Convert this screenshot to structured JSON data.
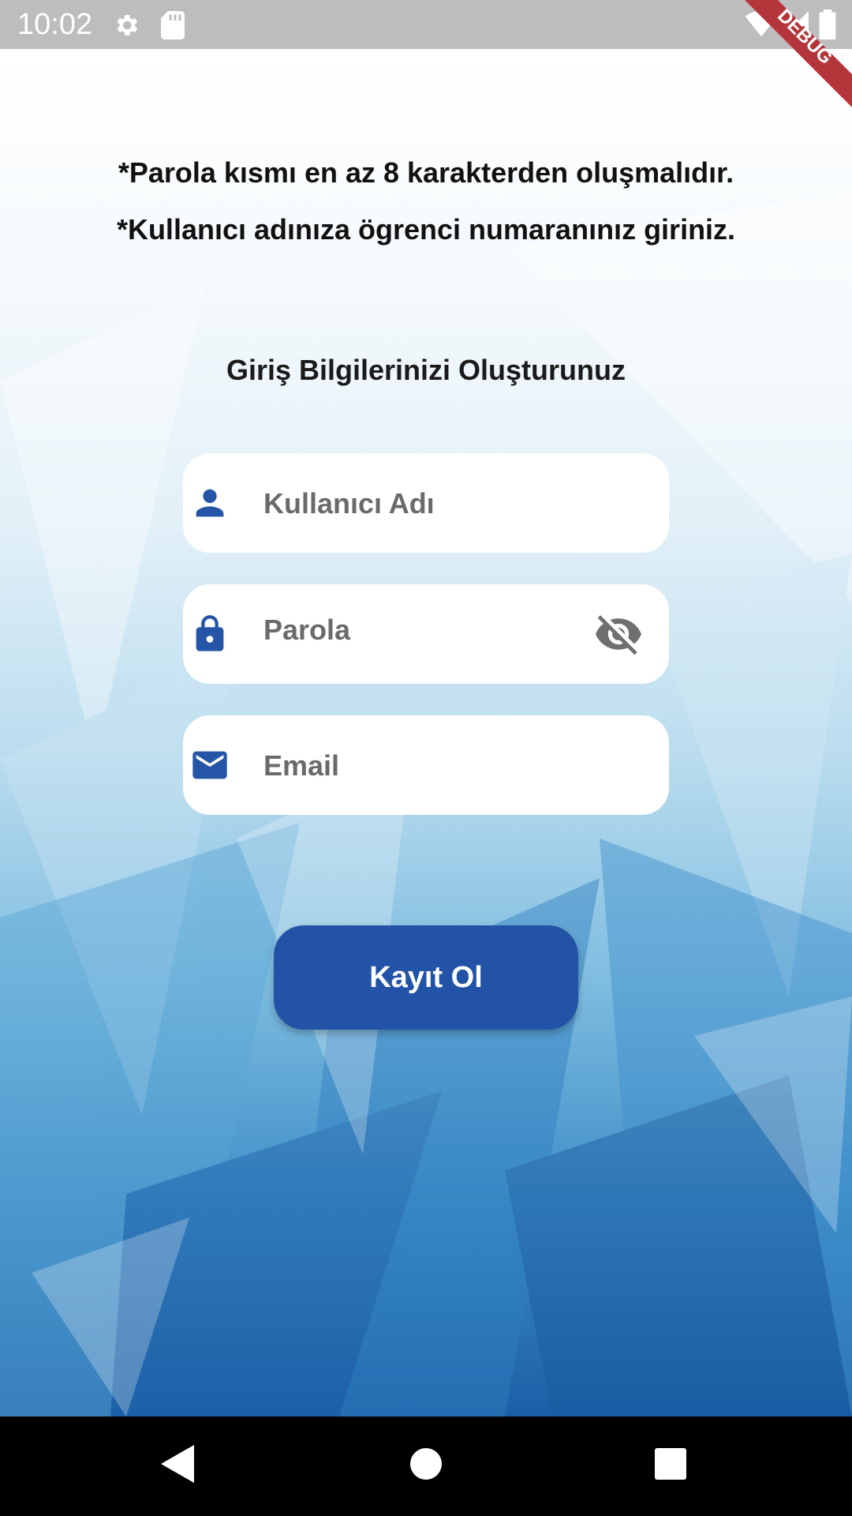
{
  "status_bar": {
    "time": "10:02"
  },
  "debug_banner": {
    "label": "DEBUG"
  },
  "instructions": {
    "line1": "*Parola kısmı en az 8 karakterden oluşmalıdır.",
    "line2": "*Kullanıcı adınıza ögrenci numaranınız giriniz."
  },
  "form": {
    "title": "Giriş Bilgilerinizi Oluşturunuz",
    "username": {
      "placeholder": "Kullanıcı Adı",
      "value": "",
      "icon": "person-icon"
    },
    "password": {
      "placeholder": "Parola",
      "value": "",
      "icon": "lock-icon",
      "toggle_icon": "eye-off-icon"
    },
    "email": {
      "placeholder": "Email",
      "value": "",
      "icon": "mail-icon"
    },
    "submit_label": "Kayıt Ol"
  },
  "colors": {
    "primary": "#2253a7",
    "icon": "#2455a6",
    "status_bar": "#bdbdbd",
    "debug_banner": "#b4363a"
  }
}
